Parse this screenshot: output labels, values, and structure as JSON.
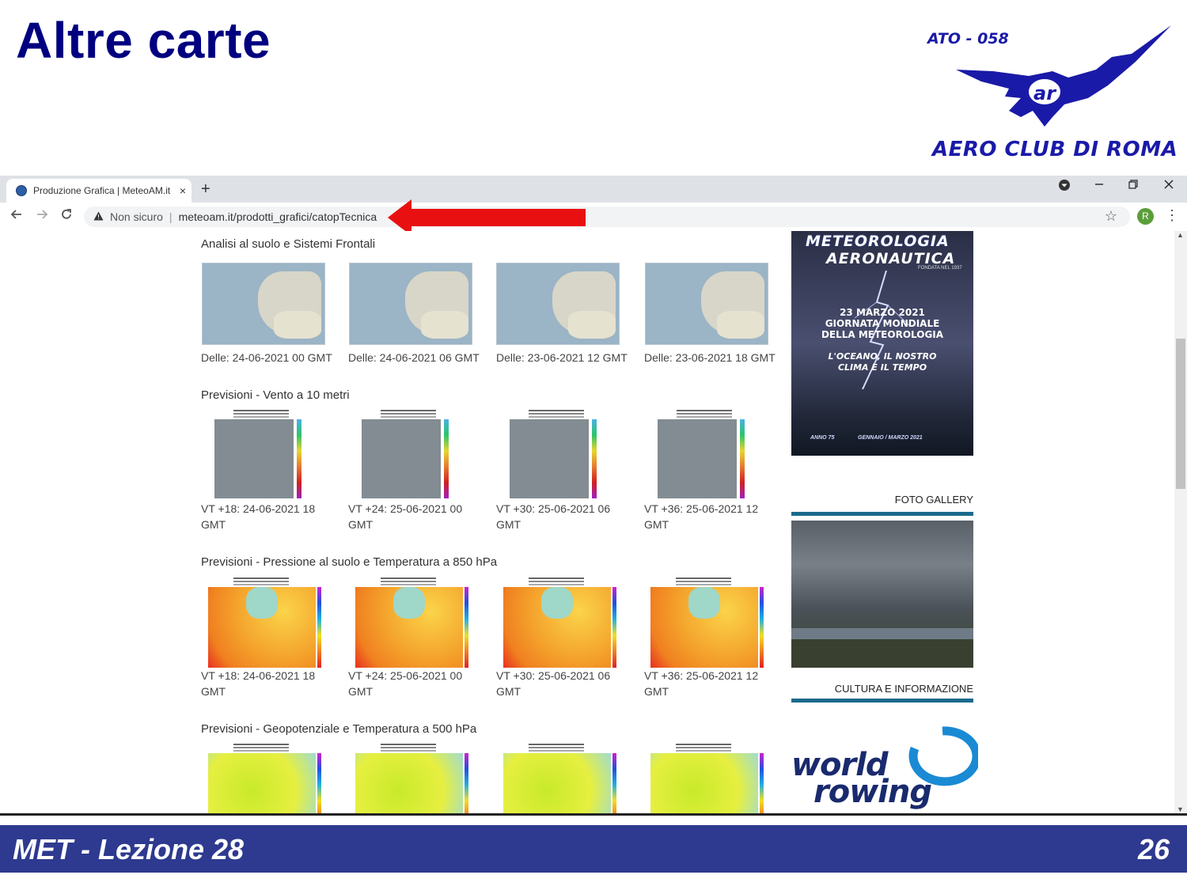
{
  "slide": {
    "title": "Altre carte",
    "logo_code": "ATO - 058",
    "logo_name": "AERO CLUB DI ROMA",
    "footer_left": "MET - Lezione 28",
    "footer_right": "26"
  },
  "browser": {
    "tab_title": "Produzione Grafica | MeteoAM.it",
    "tab_close": "×",
    "new_tab": "+",
    "security_label": "Non sicuro",
    "url": "meteoam.it/prodotti_grafici/catopTecnica",
    "profile_initial": "R"
  },
  "sections": [
    {
      "heading": "Analisi al suolo e Sistemi Frontali",
      "captions": [
        "Delle: 24-06-2021 00 GMT",
        "Delle: 24-06-2021 06 GMT",
        "Delle: 23-06-2021 12 GMT",
        "Delle: 23-06-2021 18 GMT"
      ]
    },
    {
      "heading": "Previsioni - Vento a 10 metri",
      "captions": [
        "VT +18: 24-06-2021 18 GMT",
        "VT +24: 25-06-2021 00 GMT",
        "VT +30: 25-06-2021 06 GMT",
        "VT +36: 25-06-2021 12 GMT"
      ]
    },
    {
      "heading": "Previsioni - Pressione al suolo e Temperatura a 850 hPa",
      "captions": [
        "VT +18: 24-06-2021 18 GMT",
        "VT +24: 25-06-2021 00 GMT",
        "VT +30: 25-06-2021 06 GMT",
        "VT +36: 25-06-2021 12 GMT"
      ]
    },
    {
      "heading": "Previsioni - Geopotenziale e Temperatura a 500 hPa"
    }
  ],
  "sidebar": {
    "ad_title_1": "METEOROLOGIA",
    "ad_title_2": "AERONAUTICA",
    "ad_founded": "FONDATA NEL 1937",
    "ad_date_lines": [
      "23 MARZO 2021",
      "GIORNATA MONDIALE",
      "DELLA METEOROLOGIA"
    ],
    "ad_theme_lines": [
      "L'OCEANO, IL NOSTRO",
      "CLIMA E IL TEMPO"
    ],
    "ad_year": "ANNO 75",
    "ad_issue": "GENNAIO / MARZO 2021",
    "photo_gallery_heading": "FOTO GALLERY",
    "culture_heading": "CULTURA E INFORMAZIONE",
    "world_rowing_1": "world",
    "world_rowing_2": "rowing"
  },
  "colors": {
    "title": "#000080",
    "footer_bg": "#2e3a8f",
    "logo": "#1a1aa8",
    "arrow": "#e81010"
  }
}
